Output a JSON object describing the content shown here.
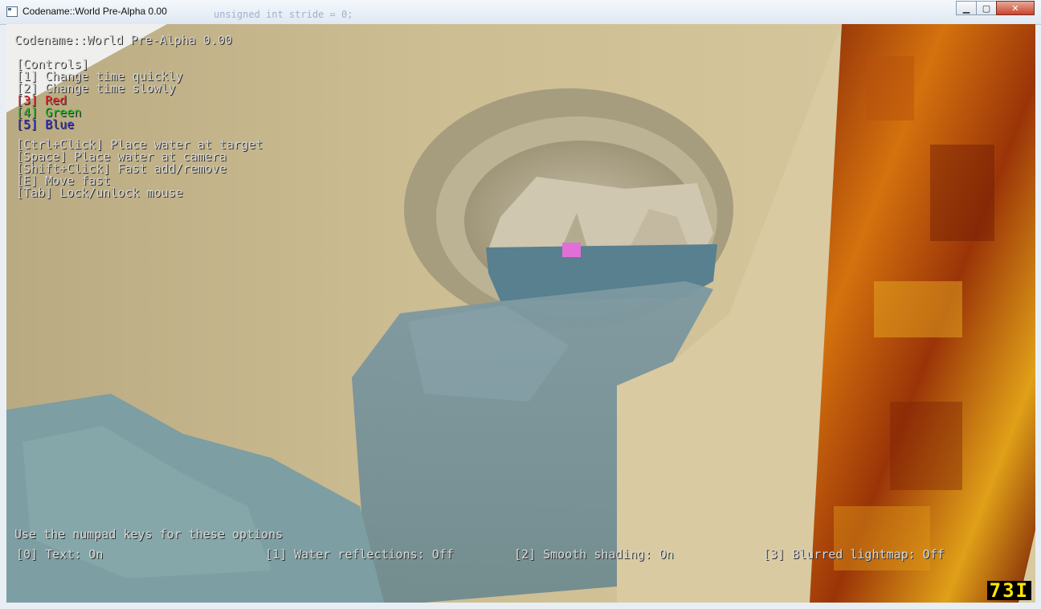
{
  "window": {
    "title": "Codename::World Pre-Alpha 0.00",
    "background_code_text": "unsigned int stride = 0;",
    "controls": {
      "minimize": "▁",
      "maximize": "▢",
      "close": "✕"
    }
  },
  "hud": {
    "title": "Codename::World Pre-Alpha 0.00",
    "controls_header": "[Controls]",
    "controls": [
      {
        "text": "[1] Change time quickly",
        "color": "#d9d9d9"
      },
      {
        "text": "[2] Change time slowly",
        "color": "#d9d9d9"
      },
      {
        "text": "[3] Red",
        "color": "#e03030"
      },
      {
        "text": "[4] Green",
        "color": "#30b830"
      },
      {
        "text": "[5] Blue",
        "color": "#3030c8"
      }
    ],
    "actions": [
      "[Ctrl+Click] Place water at target",
      "[Space] Place water at camera",
      "[Shift+Click] Fast add/remove",
      "[E] Move fast",
      "[Tab] Lock/unlock mouse"
    ],
    "numpad_hint": "Use the numpad keys for these options",
    "options": [
      "[0] Text: On",
      "[1] Water reflections: Off",
      "[2] Smooth shading: On",
      "[3] Blurred lightmap: Off"
    ],
    "fps": "73",
    "fps_suffix": "I"
  }
}
